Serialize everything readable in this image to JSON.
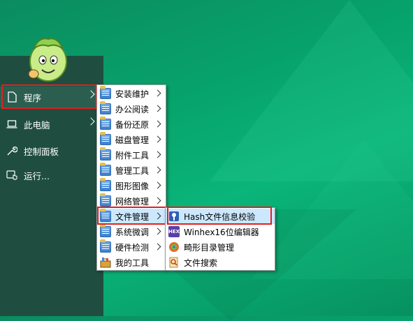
{
  "sidebar": {
    "items": [
      {
        "label": "程序",
        "icon": "document-icon",
        "has_arrow": true
      },
      {
        "label": "此电脑",
        "icon": "laptop-icon",
        "has_arrow": true
      },
      {
        "label": "控制面板",
        "icon": "wrench-icon",
        "has_arrow": false
      },
      {
        "label": "运行...",
        "icon": "run-shield-icon",
        "has_arrow": false
      }
    ]
  },
  "programs_menu": {
    "items": [
      {
        "label": "安装维护"
      },
      {
        "label": "办公阅读"
      },
      {
        "label": "备份还原"
      },
      {
        "label": "磁盘管理"
      },
      {
        "label": "附件工具"
      },
      {
        "label": "管理工具"
      },
      {
        "label": "图形图像"
      },
      {
        "label": "网络管理"
      },
      {
        "label": "文件管理"
      },
      {
        "label": "系统微调"
      },
      {
        "label": "硬件检测"
      },
      {
        "label": "我的工具"
      }
    ]
  },
  "file_mgmt_menu": {
    "items": [
      {
        "label": "Hash文件信息校验",
        "icon": "hash-icon"
      },
      {
        "label": "Winhex16位编辑器",
        "icon": "winhex-icon",
        "icon_text": "HEX"
      },
      {
        "label": "畸形目录管理",
        "icon": "folder-tool-icon"
      },
      {
        "label": "文件搜索",
        "icon": "file-search-icon"
      }
    ]
  },
  "colors": {
    "panel": "#1f4e40",
    "highlight_box": "#e02020",
    "menu_hover": "#cce8ff"
  }
}
